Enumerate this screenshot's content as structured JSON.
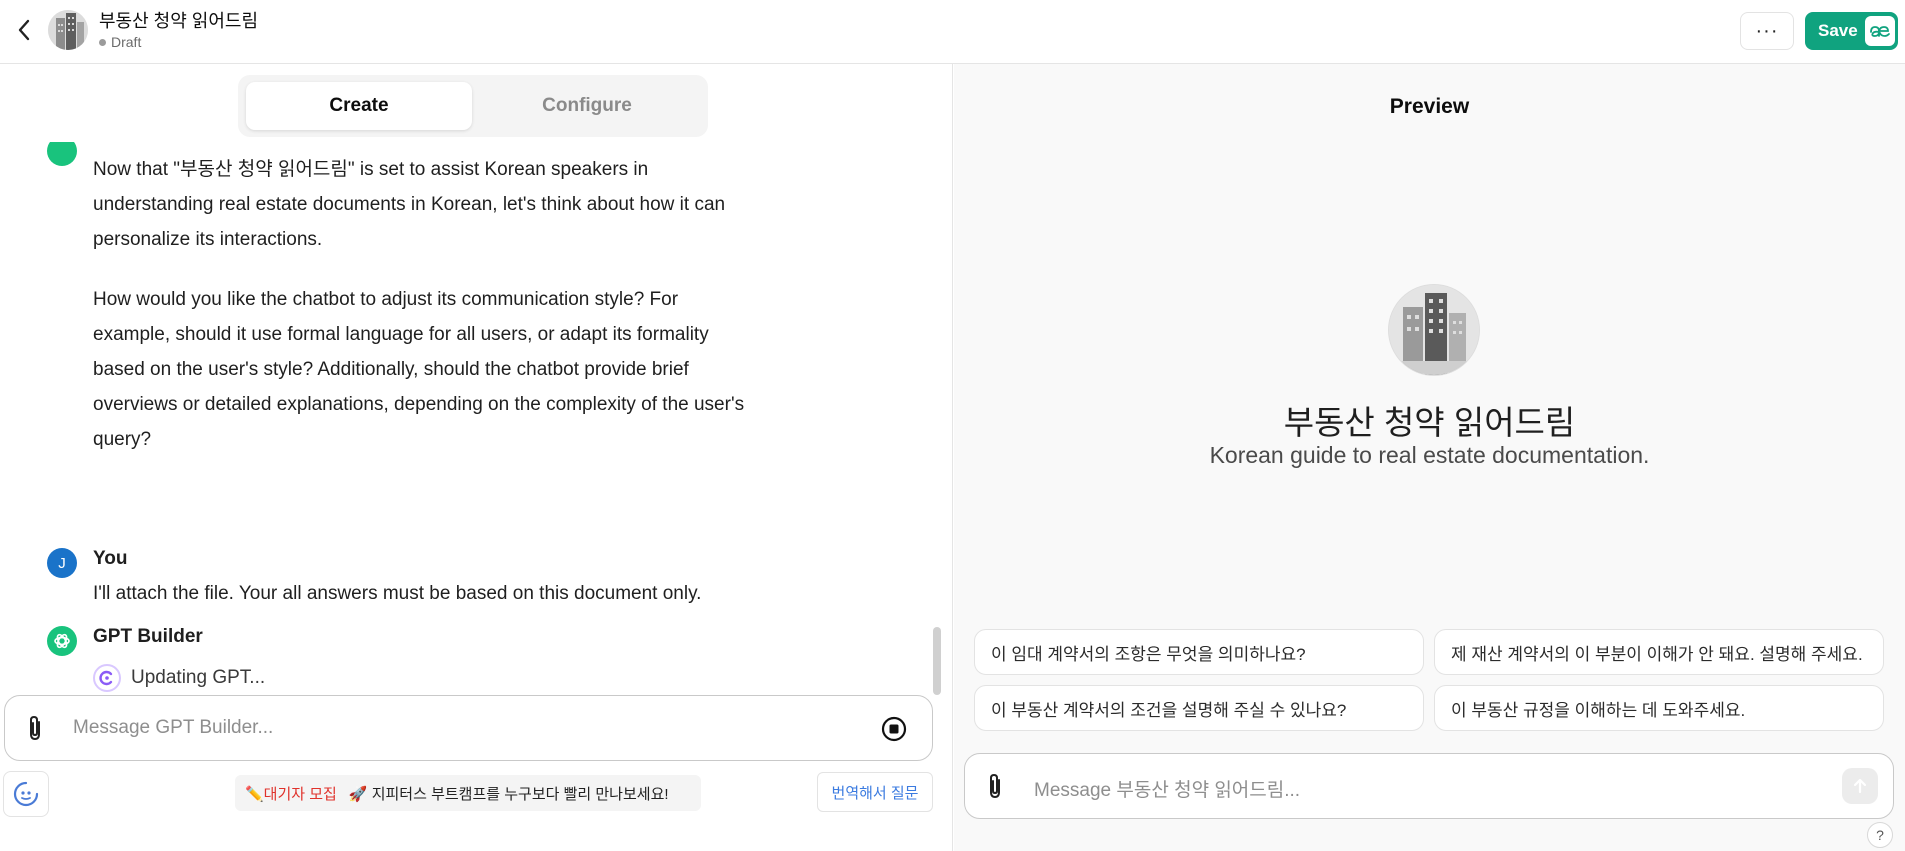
{
  "header": {
    "title": "부동산 청약 읽어드림",
    "status": "Draft",
    "more_label": "···",
    "save_label": "Save",
    "save_badge_icon": "ae-ligature-icon"
  },
  "tabs": [
    {
      "label": "Create",
      "active": true
    },
    {
      "label": "Configure",
      "active": false
    }
  ],
  "chat": {
    "messages": [
      {
        "sender": "GPT Builder",
        "text_lines": [
          "Now that \"부동산 청약 읽어드림\" is set to assist Korean speakers in",
          "understanding real estate documents in Korean, let's think about how it can",
          "personalize its interactions."
        ],
        "paragraph2_lines": [
          "How would you like the chatbot to adjust its communication style? For",
          "example, should it use formal language for all users, or adapt its formality",
          "based on the user's style? Additionally, should the chatbot provide brief",
          "overviews or detailed explanations, depending on the complexity of the user's",
          "query?"
        ]
      },
      {
        "sender": "You",
        "avatar_letter": "J",
        "text": "I'll attach the file. Your all answers must be based on this document only."
      },
      {
        "sender": "GPT Builder",
        "status": "Updating GPT..."
      }
    ]
  },
  "composer": {
    "placeholder": "Message GPT Builder..."
  },
  "banner": {
    "tag": "✏️대기자 모집",
    "text": "🚀 지피터스 부트캠프를 누구보다 빨리 만나보세요!"
  },
  "translate_label": "번역해서 질문",
  "preview": {
    "title": "Preview",
    "name": "부동산 청약 읽어드림",
    "description": "Korean guide to real estate documentation.",
    "starters": [
      "이 임대 계약서의 조항은 무엇을 의미하나요?",
      "제 재산 계약서의 이 부분이 이해가 안 돼요. 설명해 주세요.",
      "이 부동산 계약서의 조건을 설명해 주실 수 있나요?",
      "이 부동산 규정을 이해하는 데 도와주세요."
    ],
    "composer_placeholder": "Message 부동산 청약 읽어드림..."
  },
  "help_label": "?",
  "colors": {
    "accent_green": "#10a37f",
    "gpt_icon": "#19c37d",
    "user_avatar": "#1a73c9",
    "banner_red": "#e0322b",
    "translate_blue": "#3b7be0"
  }
}
